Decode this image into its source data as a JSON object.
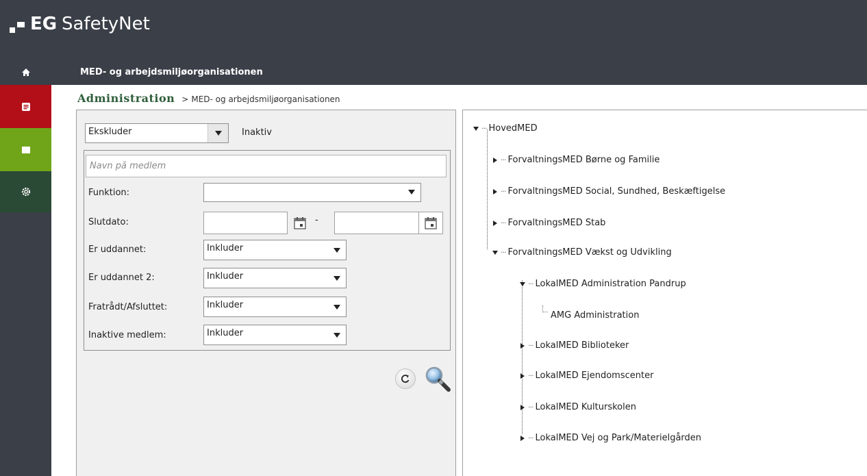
{
  "header": {
    "brand_short": "EG",
    "app_name": "SafetyNet"
  },
  "nav": {
    "items": [
      {
        "icon": "home-icon"
      },
      {
        "icon": "document-icon",
        "color": "#b30f18"
      },
      {
        "icon": "square-icon",
        "color": "#70a51a"
      },
      {
        "icon": "gear-icon",
        "color": "#2a4a35"
      }
    ]
  },
  "titlebar": {
    "title": "MED- og arbejdsmiljøorganisationen"
  },
  "breadcrumb": {
    "root": "Administration",
    "separator": ">",
    "current": "MED- og arbejdsmiljøorganisationen"
  },
  "filter": {
    "top_select_value": "Ekskluder",
    "top_select_label": "Inaktiv",
    "name_placeholder": "Navn på medlem",
    "funktion_label": "Funktion:",
    "funktion_value": "",
    "slutdato_label": "Slutdato:",
    "slutdato_from": "",
    "slutdato_to": "",
    "date_separator": "-",
    "er_uddannet_label": "Er uddannet:",
    "er_uddannet_value": "Inkluder",
    "er_uddannet2_label": "Er uddannet 2:",
    "er_uddannet2_value": "Inkluder",
    "fratraadt_label": "Fratrådt/Afsluttet:",
    "fratraadt_value": "Inkluder",
    "inaktive_label": "Inaktive medlem:",
    "inaktive_value": "Inkluder"
  },
  "tree": {
    "root": "HovedMED",
    "level1": [
      "ForvaltningsMED Børne og Familie",
      "ForvaltningsMED Social, Sundhed, Beskæftigelse",
      "ForvaltningsMED Stab",
      "ForvaltningsMED Vækst og Udvikling"
    ],
    "level2": [
      "LokalMED Administration Pandrup",
      "LokalMED Biblioteker",
      "LokalMED Ejendomscenter",
      "LokalMED Kulturskolen",
      "LokalMED Vej og Park/Materielgården"
    ],
    "level3": [
      "AMG Administration"
    ]
  },
  "colors": {
    "header_bg": "#3b3f48",
    "accent_red": "#b30f18",
    "accent_green": "#70a51a",
    "accent_dark_green": "#2a4a35",
    "breadcrumb_green": "#2f5e3a"
  }
}
